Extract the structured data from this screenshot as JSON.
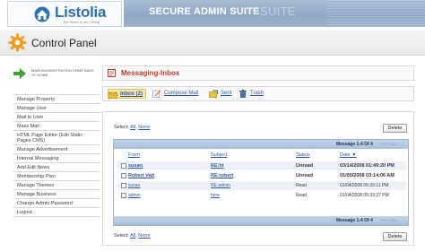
{
  "header": {
    "logo_text": "Listolia",
    "logo_tagline": "Be Home in the Listing",
    "banner_title": "SECURE ADMIN SUITE",
    "banner_ghost": "SUITE"
  },
  "control_panel": {
    "title": "Control Panel"
  },
  "sidebar": {
    "home_link": "MAIN ADMINISTRATION HOME BACK TO HOME",
    "items": [
      {
        "label": "Manage Property"
      },
      {
        "label": "Manage User"
      },
      {
        "label": "Mail to User"
      },
      {
        "label": "Mass Mail"
      },
      {
        "label": "HTML Page Editor (Edit Static Pages CMS)"
      },
      {
        "label": "Manage Advertisement"
      },
      {
        "label": "Internal Messaging"
      },
      {
        "label": "Add Edit News"
      },
      {
        "label": "Membership Plan"
      },
      {
        "label": "Manage Themes"
      },
      {
        "label": "Manage Business"
      },
      {
        "label": "Change Admin Password"
      },
      {
        "label": "Logout"
      }
    ]
  },
  "main": {
    "section_title": "Messaging-Inbox",
    "tabs": [
      {
        "label": "Inbox (2)",
        "icon": "inbox-icon",
        "active": true
      },
      {
        "label": "Compose Mail",
        "icon": "compose-icon",
        "active": false
      },
      {
        "label": "Sent",
        "icon": "sent-icon",
        "active": false
      },
      {
        "label": "Trash",
        "icon": "trash-icon",
        "active": false
      }
    ],
    "select_label": "Select:",
    "select_all": "All",
    "select_sep": ",",
    "select_none": "None",
    "delete_label": "Delete",
    "message_count": "Message 1-4 Of 4",
    "pager": "Prev  Next",
    "columns": {
      "from": "From",
      "subject": "Subject",
      "status": "Status",
      "date": "Date ▼"
    },
    "rows": [
      {
        "from": "susan",
        "subject": "RE:hi",
        "status": "Unread",
        "date": "03/14/2008 01:49:20 PM"
      },
      {
        "from": "Robert Vad",
        "subject": "RE:robert",
        "status": "Unread",
        "date": "01/05/2008 03:14:06 AM"
      },
      {
        "from": "susan",
        "subject": "RE:admin",
        "status": "Read",
        "date": "01/04/2008 05:33:11 PM"
      },
      {
        "from": "admin",
        "subject": "here",
        "status": "Read",
        "date": "01/04/2008 05:33:27 PM"
      }
    ]
  },
  "colors": {
    "accent_red": "#c0392b",
    "link_blue": "#2a55a5",
    "banner_blue": "#8ea8c6",
    "table_head": "#a9bfda"
  }
}
